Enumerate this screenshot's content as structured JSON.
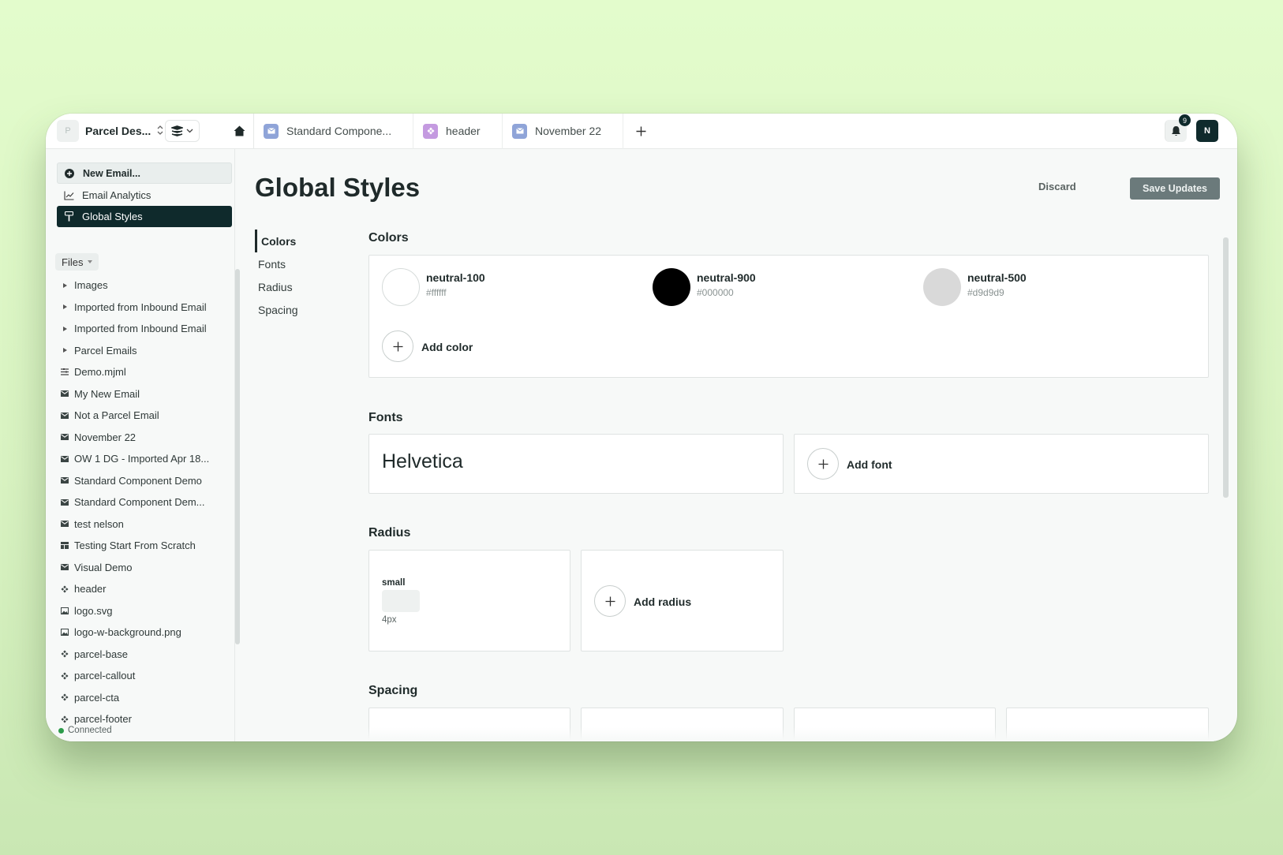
{
  "topbar": {
    "workspace_initial": "P",
    "workspace_name": "Parcel Des...",
    "tabs": [
      {
        "label": "Standard Compone...",
        "icon": "mail-icon",
        "color": "#8fa4d8"
      },
      {
        "label": "header",
        "icon": "component-icon",
        "color": "#c49ae0"
      },
      {
        "label": "November 22",
        "icon": "mail-icon",
        "color": "#8fa4d8"
      }
    ],
    "notification_count": "9",
    "user_initial": "N"
  },
  "sidebar": {
    "new_email": "New Email...",
    "email_analytics": "Email Analytics",
    "global_styles": "Global Styles",
    "files_label": "Files",
    "files": [
      {
        "label": "Images",
        "icon": "caret-right-icon"
      },
      {
        "label": "Imported from Inbound Email",
        "icon": "caret-right-icon"
      },
      {
        "label": "Imported from Inbound Email",
        "icon": "caret-right-icon"
      },
      {
        "label": "Parcel Emails",
        "icon": "caret-right-icon"
      },
      {
        "label": "Demo.mjml",
        "icon": "code-icon"
      },
      {
        "label": "My New Email",
        "icon": "mail-icon"
      },
      {
        "label": "Not a Parcel Email",
        "icon": "mail-icon"
      },
      {
        "label": "November 22",
        "icon": "mail-icon"
      },
      {
        "label": "OW 1 DG - Imported Apr 18...",
        "icon": "mail-icon"
      },
      {
        "label": "Standard Component Demo",
        "icon": "mail-icon"
      },
      {
        "label": "Standard Component Dem...",
        "icon": "mail-icon"
      },
      {
        "label": "test nelson",
        "icon": "mail-icon"
      },
      {
        "label": "Testing Start From Scratch",
        "icon": "template-icon"
      },
      {
        "label": "Visual Demo",
        "icon": "mail-icon"
      },
      {
        "label": "header",
        "icon": "component-icon"
      },
      {
        "label": "logo.svg",
        "icon": "image-icon"
      },
      {
        "label": "logo-w-background.png",
        "icon": "image-icon"
      },
      {
        "label": "parcel-base",
        "icon": "component-icon"
      },
      {
        "label": "parcel-callout",
        "icon": "component-icon"
      },
      {
        "label": "parcel-cta",
        "icon": "component-icon"
      },
      {
        "label": "parcel-footer",
        "icon": "component-icon"
      }
    ],
    "status": "Connected"
  },
  "main": {
    "title": "Global Styles",
    "discard": "Discard",
    "save": "Save Updates",
    "subnav": [
      "Colors",
      "Fonts",
      "Radius",
      "Spacing"
    ],
    "colors_title": "Colors",
    "colors": [
      {
        "name": "neutral-100",
        "hex": "#ffffff"
      },
      {
        "name": "neutral-900",
        "hex": "#000000"
      },
      {
        "name": "neutral-500",
        "hex": "#d9d9d9"
      }
    ],
    "add_color": "Add color",
    "fonts_title": "Fonts",
    "font_name": "Helvetica",
    "add_font": "Add font",
    "radius_title": "Radius",
    "radius_name": "small",
    "radius_value": "4px",
    "add_radius": "Add radius",
    "spacing_title": "Spacing"
  }
}
